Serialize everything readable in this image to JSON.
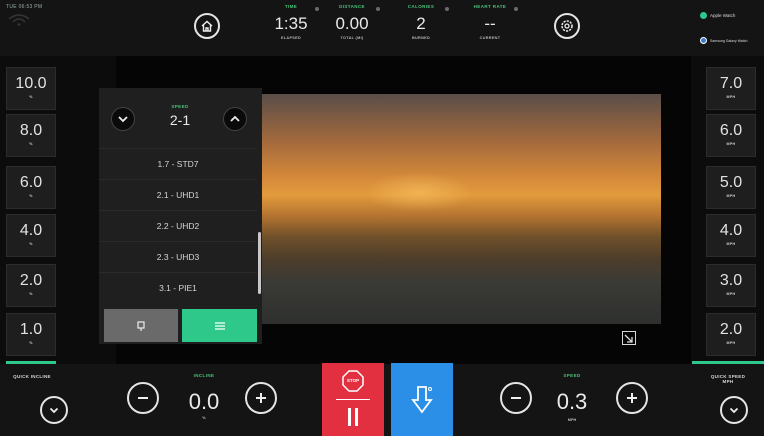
{
  "top_bar": {
    "clock": "TUE 06:53 PM",
    "stats": [
      {
        "label": "TIME",
        "value": "1:35",
        "sub": "ELAPSED"
      },
      {
        "label": "DISTANCE",
        "value": "0.00",
        "sub": "TOTAL (MI)"
      },
      {
        "label": "CALORIES",
        "value": "2",
        "sub": "BURNED"
      },
      {
        "label": "HEART RATE",
        "value": "--",
        "sub": "CURRENT"
      }
    ],
    "apple_watch_label": "Apple Watch",
    "badge2_label": "Samsung Galaxy Watch",
    "icons": [
      "home-icon",
      "settings-icon",
      "wifi-icon"
    ]
  },
  "incline_presets": {
    "unit": "%",
    "values": [
      "10.0",
      "8.0",
      "6.0",
      "4.0",
      "2.0",
      "1.0"
    ]
  },
  "speed_presets": {
    "unit": "MPH",
    "values": [
      "7.0",
      "6.0",
      "5.0",
      "4.0",
      "3.0",
      "2.0"
    ]
  },
  "segment_panel": {
    "label": "SPEED",
    "value": "2-1",
    "items": [
      "1.7 - STD7",
      "2.1 - UHD1",
      "2.2 - UHD2",
      "2.3 - UHD3",
      "3.1 - PIE1"
    ]
  },
  "bottom_bar": {
    "quick_incline_label": "QUICK INCLINE",
    "incline": {
      "label": "INCLINE",
      "value": "0.0",
      "unit": "%"
    },
    "speed": {
      "label": "SPEED",
      "value": "0.3",
      "unit": "MPH"
    },
    "quick_speed_label": "QUICK SPEED",
    "quick_speed_unit": "MPH",
    "stop_label": "STOP"
  },
  "colors": {
    "accent_green": "#2fc88b",
    "stop_red": "#e23040",
    "action_blue": "#2b8fe7"
  }
}
